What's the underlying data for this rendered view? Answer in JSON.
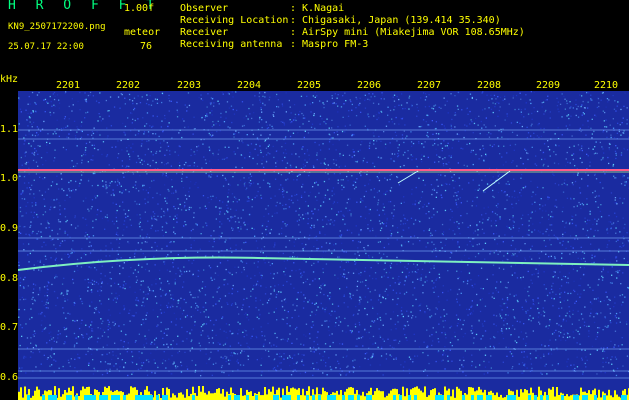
{
  "header": {
    "app_title": "H R O F F T",
    "version": "1.00f",
    "filename": "KN9_2507172200.png",
    "meteor_label": "meteor",
    "datetime": "25.07.17 22:00",
    "count": "76",
    "info": [
      {
        "label": "Observer",
        "value": ": K.Nagai"
      },
      {
        "label": "Receiving Location",
        "value": ": Chigasaki, Japan (139.414 35.340)"
      },
      {
        "label": "Receiver",
        "value": ": AirSpy mini (Miakejima VOR 108.65MHz)"
      },
      {
        "label": "Receiving antenna",
        "value": ": Maspro FM-3"
      }
    ]
  },
  "axis": {
    "unit": "kHz",
    "y_ticks": [
      "1.1",
      "1.0",
      "0.9",
      "0.8",
      "0.7",
      "0.6"
    ],
    "x_ticks": [
      "2201",
      "2202",
      "2203",
      "2204",
      "2205",
      "2206",
      "2207",
      "2208",
      "2209",
      "2210"
    ]
  },
  "colors": {
    "background": "#1a2ba0",
    "label": "#ffff00",
    "title": "#00ff80",
    "carrier": "#ff5a8a",
    "trace": "#7ef0c0",
    "noise_bar": "#ffff00",
    "noise_base": "#00e0ff"
  }
}
